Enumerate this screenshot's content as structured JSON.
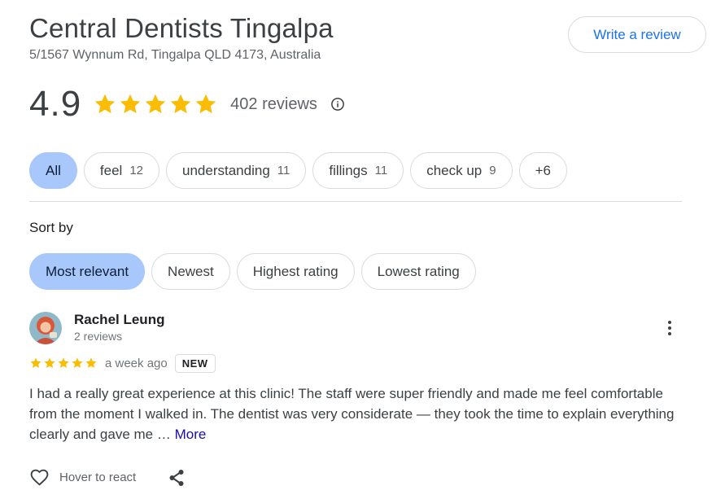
{
  "place": {
    "name": "Central Dentists Tingalpa",
    "address": "5/1567 Wynnum Rd, Tingalpa QLD 4173, Australia",
    "write_review_label": "Write a review"
  },
  "rating": {
    "value": "4.9",
    "stars": 5,
    "reviews_label": "402 reviews",
    "info_icon": "info-icon",
    "star_color": "#fbbc04"
  },
  "topic_chips": [
    {
      "label": "All",
      "count": "",
      "active": true
    },
    {
      "label": "feel",
      "count": "12",
      "active": false
    },
    {
      "label": "understanding",
      "count": "11",
      "active": false
    },
    {
      "label": "fillings",
      "count": "11",
      "active": false
    },
    {
      "label": "check up",
      "count": "9",
      "active": false
    },
    {
      "label": "+6",
      "count": "",
      "active": false
    }
  ],
  "sort": {
    "label": "Sort by",
    "options": [
      {
        "label": "Most relevant",
        "active": true
      },
      {
        "label": "Newest",
        "active": false
      },
      {
        "label": "Highest rating",
        "active": false
      },
      {
        "label": "Lowest rating",
        "active": false
      }
    ]
  },
  "review": {
    "reviewer_name": "Rachel Leung",
    "reviewer_meta": "2 reviews",
    "stars": 5,
    "date": "a week ago",
    "badge": "NEW",
    "text": "I had a really great experience at this clinic! The staff were super friendly and made me feel comfortable from the moment I walked in. The dentist was very considerate — they took the time to explain everything clearly and gave me … ",
    "more_label": "More",
    "react_label": "Hover to react",
    "menu_icon": "more-vert-icon",
    "react_icon": "heart-icon",
    "share_icon": "share-icon"
  },
  "colors": {
    "accent": "#1a73e8",
    "active_chip": "#a8c7fa",
    "star": "#fbbc04"
  }
}
